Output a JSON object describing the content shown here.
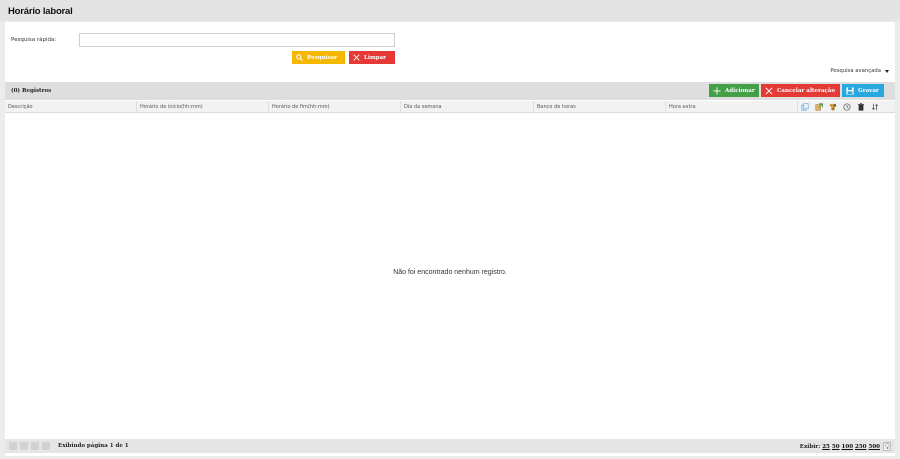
{
  "header": {
    "title": "Horário laboral"
  },
  "quick_search": {
    "label": "Pesquisa rápida:",
    "value": "",
    "placeholder": ""
  },
  "buttons": {
    "search": "Pesquisar",
    "clear": "Limpar"
  },
  "advanced_search": {
    "label": "Pesquisa avançada"
  },
  "grid": {
    "count_label": "(0) Registros",
    "actions": {
      "add": "Adicionar",
      "cancel": "Cancelar alteração",
      "save": "Gravar"
    },
    "columns": [
      "Descrição",
      "Horário de início(hh:mm)",
      "Horário de fim(hh:mm)",
      "Dia da semana",
      "Banco de horas",
      "Hora extra"
    ],
    "tool_icons": [
      "copy-icon",
      "export-icon",
      "filter-icon",
      "history-icon",
      "delete-icon",
      "sort-icon"
    ],
    "empty_message": "Não foi encontrado nenhum registro."
  },
  "footer": {
    "page_info": "Exibindo página 1 de 1",
    "show_label": "Exibir:",
    "page_sizes": [
      "25",
      "50",
      "100",
      "250",
      "500"
    ]
  },
  "colors": {
    "search": "#f5b800",
    "clear": "#e53935",
    "add": "#43a047",
    "cancel": "#e53935",
    "save": "#29a8e0"
  }
}
